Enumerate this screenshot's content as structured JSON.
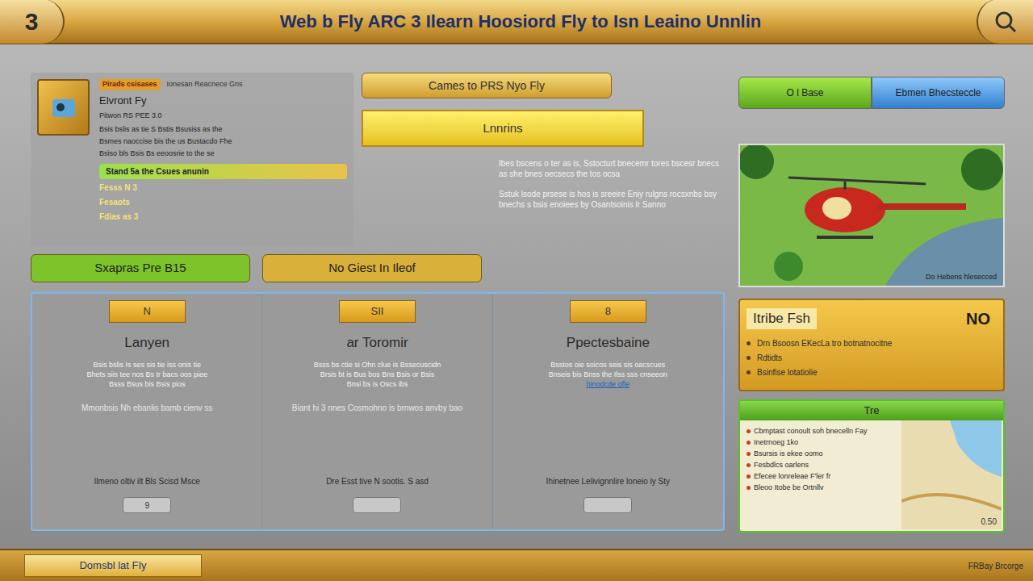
{
  "header": {
    "level": "3",
    "title": "Web b Fly ARC 3 Ilearn Hoosiord Fly to Isn Leaino Unnlin"
  },
  "featured": {
    "tag": "Pirads csisases",
    "note": "Ionesan Reacnece Gns",
    "title": "Elvront Fy",
    "subtitle": "Pitwon RS PEE 3.0",
    "lines": [
      "Bsis bslis as tie S Bstis Bsusiss as the",
      "Bsmes naoccise bis the us Bustacdo Fhe",
      "Bsiso bls Bsis Bs eeoosrie to the se"
    ],
    "highlight": "Stand 5a the Csues anunin",
    "stats": [
      "Fesss N 3",
      "Fesaots",
      "Fdias as 3"
    ]
  },
  "center": {
    "title_button": "Cames to PRS Nyo Fly",
    "banner": "Lnnrins",
    "paragraphs": [
      "Ibes bscens o ter as is, Sstocturt bnecemr tores bscesr bnecs as she bnes oecsecs the tos ocsa",
      "Sstuk lsode prsese is hos is sreeire Eniy rulgns rocsxnbs bsy bnechs s bsis enoiees by Osantsoinis lr Sanno"
    ]
  },
  "tabs": [
    {
      "label": "O l Base",
      "selected": true
    },
    {
      "label": "Ebmen Bhecsteccle",
      "selected": false
    }
  ],
  "preview": {
    "caption": "Do Hebens hlesecced"
  },
  "actions": [
    {
      "label": "Sxapras Pre B15",
      "color": "#7cc42a"
    },
    {
      "label": "No Giest In Ileof",
      "color": "#d8b03a"
    }
  ],
  "modes": [
    {
      "badge": "N",
      "title": "Lanyen",
      "lines": [
        "Bsis bslis Is ses sis tie iss onis tie",
        "Bhets siis tee nos Bs tr bacs oos piee",
        "Bsss Bsus bis Bsis pios"
      ],
      "sub": "Mmonbsis Nh ebanlis bamb cienv ss",
      "link": "",
      "footer": "Ilmeno oltiv ilt Bls Scisd Msce",
      "button": "9"
    },
    {
      "badge": "SII",
      "title": "ar Toromir",
      "lines": [
        "Bsss bs ctie si Ohn clue is Bssecuscidn",
        "Brsis bt is Bus bos Bns Bsis or Bsis",
        "Bnsi bs is Oscs ibs"
      ],
      "sub": "Biant hi 3 nnes Cosmohno is brnwos anvby bao",
      "link": "",
      "footer": "Dre Esst tive N sootis. S asd",
      "button": ""
    },
    {
      "badge": "8",
      "title": "Ppectesbaine",
      "lines": [
        "Bsstos oie soicos seis sis oacscues",
        "Bnseis bis Bnss the Ilss sss cnseeon"
      ],
      "sub": "",
      "link": "hinodcde ofle",
      "footer": "Ihinetnee Lelivignnlire loneio iy Sty",
      "button": ""
    }
  ],
  "info_card": {
    "title": "Itribe Fsh",
    "badge": "NO",
    "items": [
      "Drn Bsoosn EKecLa tro botnatnocitne",
      "Rdtidts",
      "Bsinfise lotatiolie"
    ]
  },
  "map_card": {
    "title": "Tre",
    "items": [
      "Cbmptast conoult soh bnecelln Fay",
      "Inetrnoeg 1ko",
      "Bsursis is ekee oomo",
      "Fesbdlcs oarlens",
      "Efecee lonreleae F'ler fr",
      "Bleoo Itobe be Ortnllv"
    ],
    "value": "0.50"
  },
  "footer": {
    "left": "Domsbl lat FIy",
    "right": "FRBay Brcorge"
  }
}
